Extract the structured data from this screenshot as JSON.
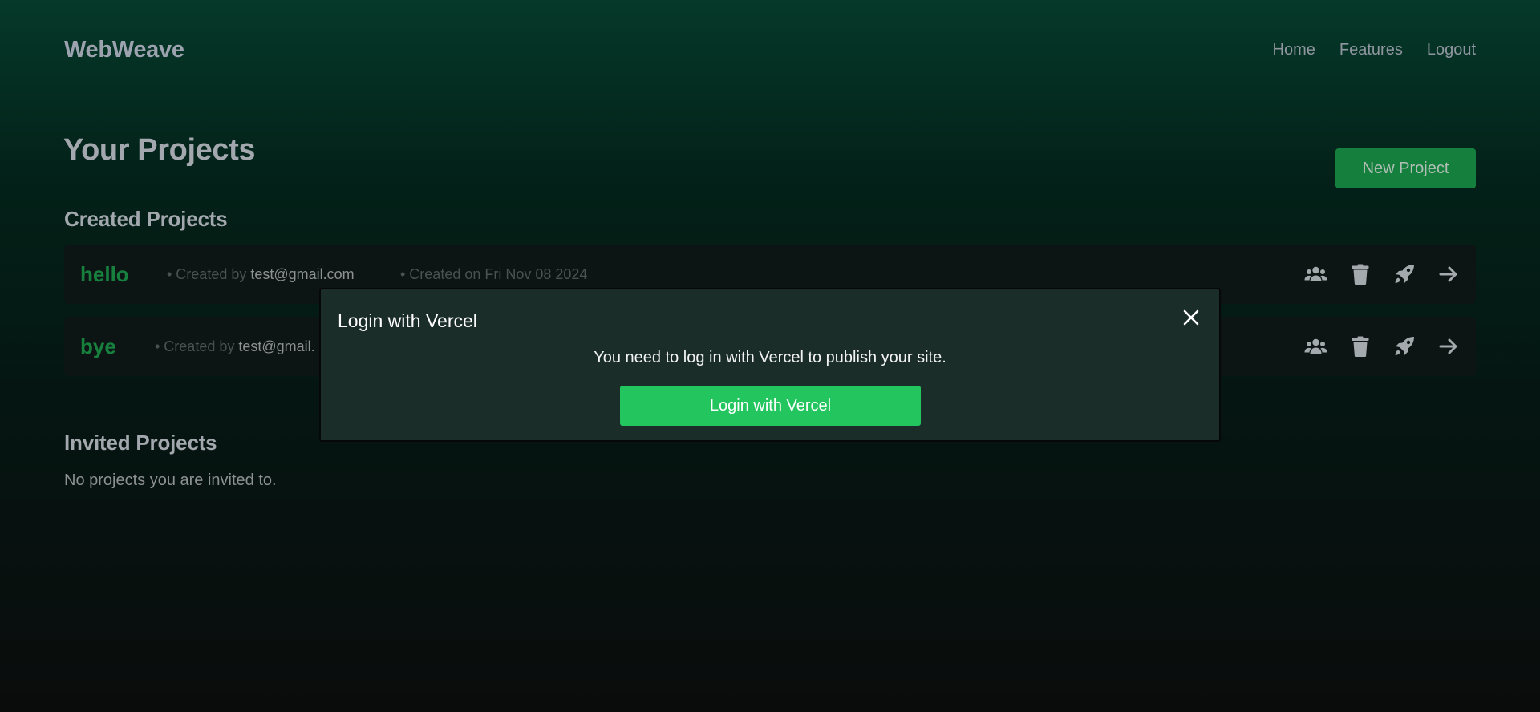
{
  "header": {
    "brand": "WebWeave",
    "nav": [
      "Home",
      "Features",
      "Logout"
    ]
  },
  "main": {
    "title": "Your Projects",
    "new_project_label": "New Project",
    "created_section_title": "Created Projects",
    "projects": [
      {
        "name": "hello",
        "created_by_prefix": "• Created by ",
        "created_by": "test@gmail.com",
        "created_on": "• Created on Fri Nov 08 2024"
      },
      {
        "name": "bye",
        "created_by_prefix": "• Created by ",
        "created_by": "test@gmail."
      }
    ],
    "invited_section_title": "Invited Projects",
    "invited_empty": "No projects you are invited to.",
    "action_icons": [
      "users-icon",
      "trash-icon",
      "rocket-icon",
      "arrow-right-icon"
    ]
  },
  "modal": {
    "title": "Login with Vercel",
    "message": "You need to log in with Vercel to publish your site.",
    "button_label": "Login with Vercel",
    "close_icon": "close-icon"
  },
  "colors": {
    "accent_green": "#22c55e",
    "project_name_green": "#17803e",
    "new_project_bg": "#15803d",
    "modal_bg": "#1b2d28"
  }
}
